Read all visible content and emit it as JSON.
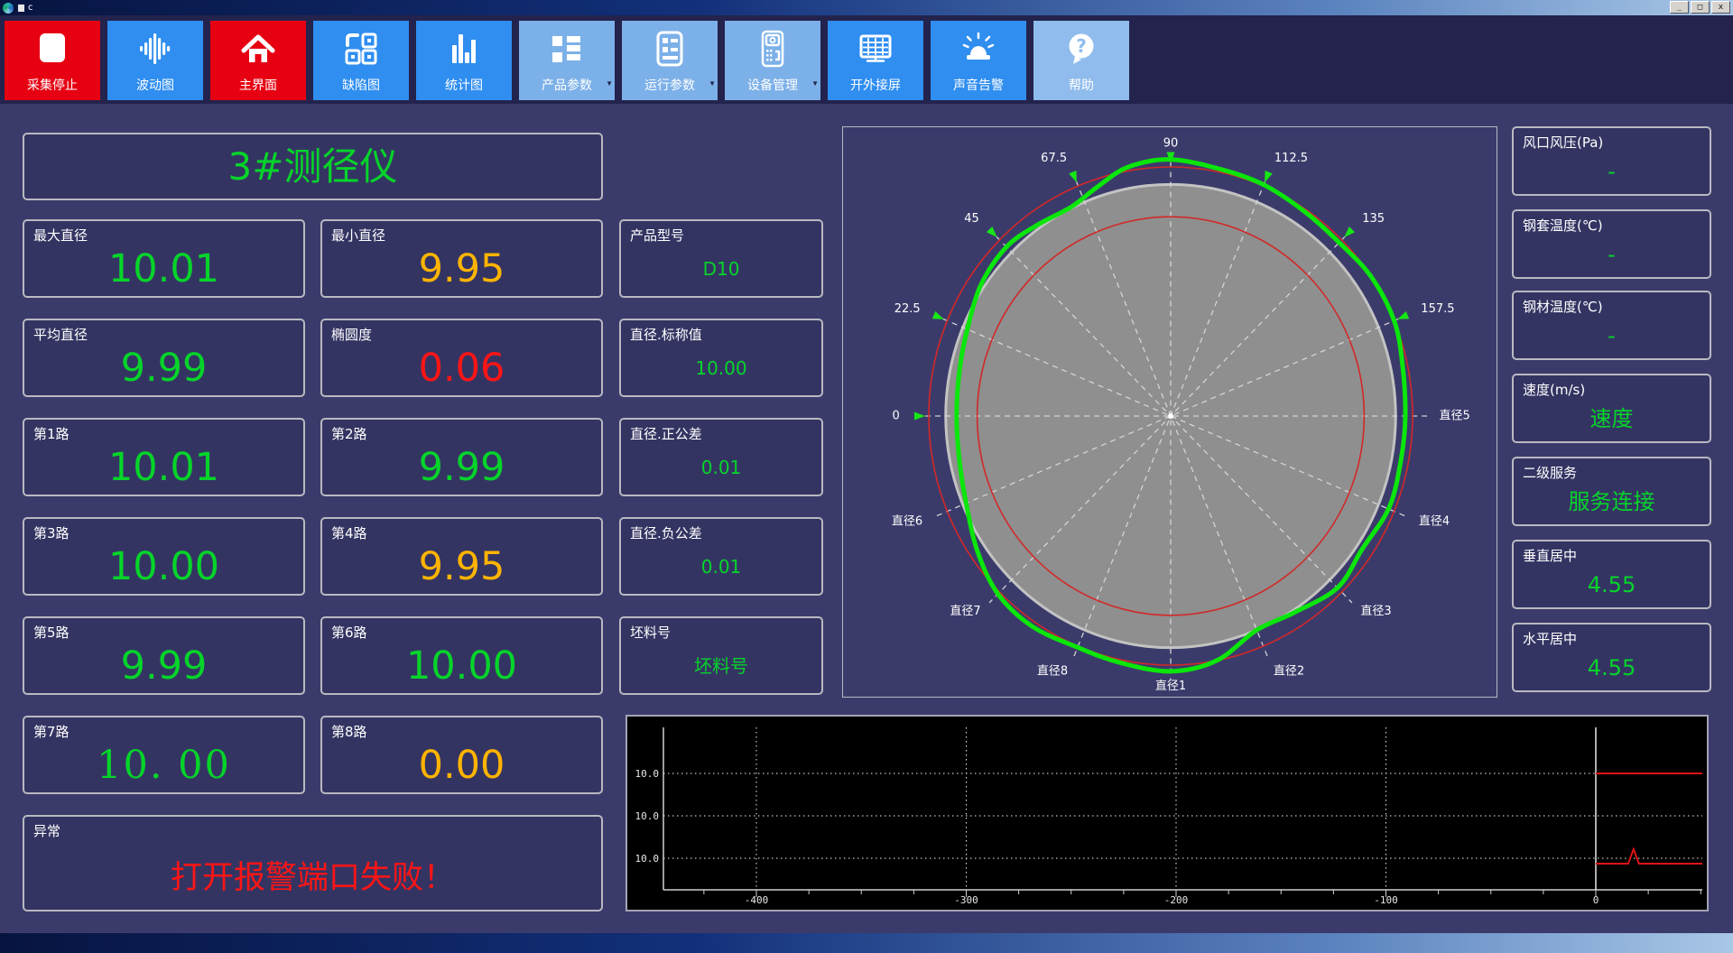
{
  "window": {
    "title": "c",
    "controls": [
      {
        "name": "minimize",
        "glyph": "_"
      },
      {
        "name": "maximize",
        "glyph": "□"
      },
      {
        "name": "close",
        "glyph": "x"
      }
    ]
  },
  "toolbar": {
    "buttons": [
      {
        "name": "stop-acquisition",
        "label": "采集停止",
        "icon": "stop-icon",
        "color": "red"
      },
      {
        "name": "wave-chart",
        "label": "波动图",
        "icon": "waveform-icon",
        "color": "blue"
      },
      {
        "name": "main-screen",
        "label": "主界面",
        "icon": "home-icon",
        "color": "red"
      },
      {
        "name": "defect-map",
        "label": "缺陷图",
        "icon": "defect-map-icon",
        "color": "blue"
      },
      {
        "name": "statistics-chart",
        "label": "统计图",
        "icon": "bar-chart-icon",
        "color": "blue"
      },
      {
        "name": "product-params",
        "label": "产品参数",
        "icon": "product-params-icon",
        "color": "lightblue",
        "dropdown": true
      },
      {
        "name": "run-params",
        "label": "运行参数",
        "icon": "run-params-icon",
        "color": "lightblue",
        "dropdown": true
      },
      {
        "name": "device-management",
        "label": "设备管理",
        "icon": "device-manage-icon",
        "color": "lightblue",
        "dropdown": true
      },
      {
        "name": "external-screen",
        "label": "开外接屏",
        "icon": "external-screen-icon",
        "color": "blue"
      },
      {
        "name": "sound-alarm",
        "label": "声音告警",
        "icon": "sound-alarm-icon",
        "color": "blue"
      },
      {
        "name": "help",
        "label": "帮助",
        "icon": "help-icon",
        "color": "help"
      }
    ]
  },
  "left_panel": {
    "title": "3#测径仪",
    "metrics": [
      {
        "name": "max-diameter",
        "label": "最大直径",
        "value": "10.01",
        "color": "green"
      },
      {
        "name": "min-diameter",
        "label": "最小直径",
        "value": "9.95",
        "color": "orange"
      },
      {
        "name": "avg-diameter",
        "label": "平均直径",
        "value": "9.99",
        "color": "green"
      },
      {
        "name": "ovality",
        "label": "椭圆度",
        "value": "0.06",
        "color": "red"
      },
      {
        "name": "path-1",
        "label": "第1路",
        "value": "10.01",
        "color": "green"
      },
      {
        "name": "path-2",
        "label": "第2路",
        "value": "9.99",
        "color": "green"
      },
      {
        "name": "path-3",
        "label": "第3路",
        "value": "10.00",
        "color": "green"
      },
      {
        "name": "path-4",
        "label": "第4路",
        "value": "9.95",
        "color": "orange"
      },
      {
        "name": "path-5",
        "label": "第5路",
        "value": "9.99",
        "color": "green"
      },
      {
        "name": "path-6",
        "label": "第6路",
        "value": "10.00",
        "color": "green"
      },
      {
        "name": "path-7",
        "label": "第7路",
        "value": "10. 00",
        "color": "green",
        "font": "serif"
      },
      {
        "name": "path-8",
        "label": "第8路",
        "value": "0.00",
        "color": "orange"
      }
    ],
    "params": [
      {
        "name": "product-model",
        "label": "产品型号",
        "value": "D10",
        "color": "green"
      },
      {
        "name": "diameter-nominal",
        "label": "直径.标称值",
        "value": "10.00",
        "color": "green"
      },
      {
        "name": "diameter-plus-tolerance",
        "label": "直径.正公差",
        "value": "0.01",
        "color": "green"
      },
      {
        "name": "diameter-minus-tolerance",
        "label": "直径.负公差",
        "value": "0.01",
        "color": "green"
      },
      {
        "name": "billet-number",
        "label": "坯料号",
        "value": "坯料号",
        "color": "green"
      }
    ],
    "alarm": {
      "label": "异常",
      "value": "打开报警端口失败！",
      "color": "red"
    }
  },
  "right_panel": {
    "items": [
      {
        "name": "tuyere-pressure",
        "label": "风口风压(Pa)",
        "value": "-",
        "color": "green"
      },
      {
        "name": "sleeve-temperature",
        "label": "钢套温度(℃)",
        "value": "-",
        "color": "green"
      },
      {
        "name": "steel-temperature",
        "label": "钢材温度(℃)",
        "value": "-",
        "color": "green"
      },
      {
        "name": "speed",
        "label": "速度(m/s)",
        "value": "速度",
        "color": "green"
      },
      {
        "name": "secondary-service",
        "label": "二级服务",
        "value": "服务连接",
        "color": "green"
      },
      {
        "name": "vertical-centering",
        "label": "垂直居中",
        "value": "4.55",
        "color": "green"
      },
      {
        "name": "horizontal-centering",
        "label": "水平居中",
        "value": "4.55",
        "color": "green"
      }
    ]
  },
  "polar": {
    "type": "polar-profile",
    "angle_ticks": [
      {
        "label": "0",
        "angle_deg": 180
      },
      {
        "label": "22.5",
        "angle_deg": 157.5
      },
      {
        "label": "45",
        "angle_deg": 135
      },
      {
        "label": "67.5",
        "angle_deg": 112.5
      },
      {
        "label": "90",
        "angle_deg": 90
      },
      {
        "label": "112.5",
        "angle_deg": 67.5
      },
      {
        "label": "135",
        "angle_deg": 45
      },
      {
        "label": "157.5",
        "angle_deg": 22.5
      }
    ],
    "diameter_labels": [
      {
        "label": "直径5",
        "angle_deg": 0
      },
      {
        "label": "直径4",
        "angle_deg": -22.5
      },
      {
        "label": "直径3",
        "angle_deg": -45
      },
      {
        "label": "直径2",
        "angle_deg": -67.5
      },
      {
        "label": "直径1",
        "angle_deg": -90
      },
      {
        "label": "直径8",
        "angle_deg": -112.5
      },
      {
        "label": "直径7",
        "angle_deg": -135
      },
      {
        "label": "直径6",
        "angle_deg": -157.5
      }
    ],
    "rings": {
      "gray_radius": 0.93,
      "red_outer_radius": 1.0,
      "red_inner_radius": 0.8
    },
    "profile_points": [
      [
        0,
        0.97
      ],
      [
        12,
        0.98
      ],
      [
        22.5,
        1.0
      ],
      [
        34,
        1.0
      ],
      [
        45,
        0.985
      ],
      [
        56,
        0.99
      ],
      [
        67.5,
        1.005
      ],
      [
        78,
        1.012
      ],
      [
        90,
        1.03
      ],
      [
        100,
        1.015
      ],
      [
        108,
        0.97
      ],
      [
        116,
        0.935
      ],
      [
        126,
        0.945
      ],
      [
        135,
        0.96
      ],
      [
        146,
        0.945
      ],
      [
        157.5,
        0.91
      ],
      [
        168,
        0.892
      ],
      [
        180,
        0.885
      ],
      [
        192,
        0.892
      ],
      [
        202.5,
        0.915
      ],
      [
        214,
        0.965
      ],
      [
        225,
        1.01
      ],
      [
        236,
        1.02
      ],
      [
        247.5,
        1.005
      ],
      [
        258,
        1.012
      ],
      [
        270,
        1.025
      ],
      [
        281,
        1.0
      ],
      [
        292.5,
        0.93
      ],
      [
        303,
        0.94
      ],
      [
        315,
        0.975
      ],
      [
        326,
        0.955
      ],
      [
        338,
        0.975
      ],
      [
        350,
        0.968
      ]
    ]
  },
  "bottom_chart": {
    "type": "line",
    "x_axis_ticks": [
      "-400",
      "-300",
      "-200",
      "-100",
      "0"
    ],
    "x_tick_values": [
      -400,
      -300,
      -200,
      -100,
      0
    ],
    "x_minor_step": 25,
    "x_range": [
      -440,
      50
    ],
    "y_axis_labels": [
      "10.0",
      "10.0",
      "10.0"
    ],
    "cursor_x": 0,
    "red_upper_trace": {
      "from_x": 0,
      "to_x": 50,
      "position": "on top 10.0 gridline"
    },
    "red_lower_trace": {
      "from_x": 0,
      "to_x": 50,
      "spike_x": 18,
      "position": "just below bottom 10.0 gridline"
    }
  },
  "colors": {
    "green": "#06d42a",
    "orange": "#ffb400",
    "red": "#ff1515",
    "white": "#ffffff",
    "red_button": "#e60012",
    "blue_button": "#2f8ef0",
    "lightblue_button": "#7cb0e8",
    "help_button": "#8fbcec",
    "trace_green": "#0be60b",
    "tolerance_red": "#d22828",
    "gray_disc": "#8f8f8f",
    "chart_red": "#e01313"
  }
}
